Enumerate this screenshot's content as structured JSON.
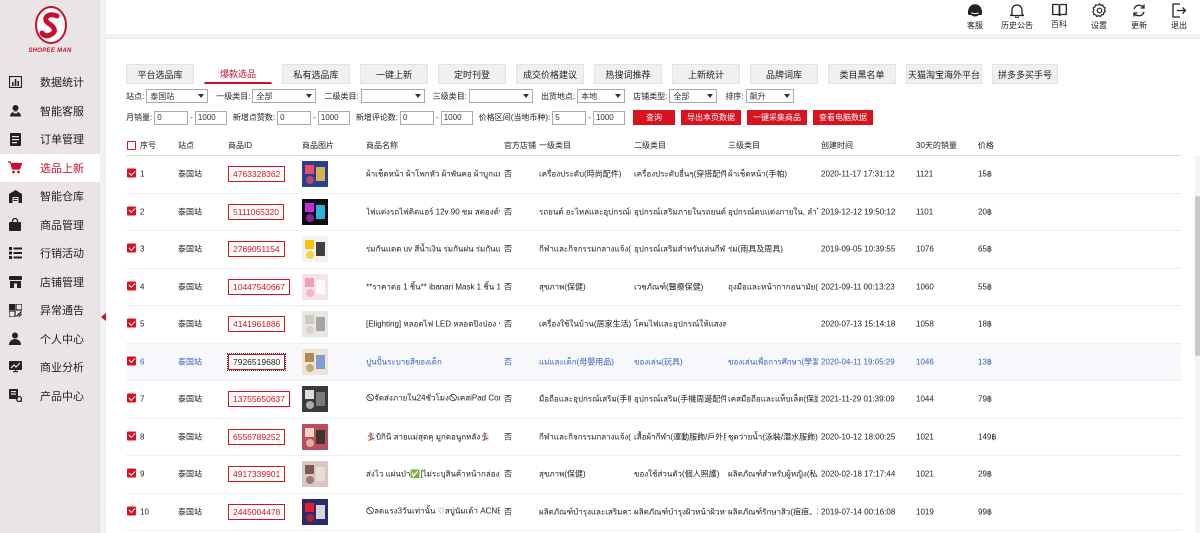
{
  "brand": {
    "logo_text": "SHOPEE MAN"
  },
  "sidebar": {
    "items": [
      {
        "label": "数据统计",
        "icon": "bar-chart-icon"
      },
      {
        "label": "智能客服",
        "icon": "user-service-icon"
      },
      {
        "label": "订单管理",
        "icon": "document-icon"
      },
      {
        "label": "选品上新",
        "icon": "cart-icon",
        "active": true
      },
      {
        "label": "智能仓库",
        "icon": "warehouse-icon"
      },
      {
        "label": "商品管理",
        "icon": "shopping-bag-icon"
      },
      {
        "label": "行销活动",
        "icon": "list-icon"
      },
      {
        "label": "店铺管理",
        "icon": "store-icon"
      },
      {
        "label": "异常通告",
        "icon": "alert-icon"
      },
      {
        "label": "个人中心",
        "icon": "person-icon"
      },
      {
        "label": "商业分析",
        "icon": "analysis-icon"
      },
      {
        "label": "产品中心",
        "icon": "product-icon"
      }
    ]
  },
  "header": {
    "icons": [
      {
        "label": "客服",
        "icon": "headset-icon"
      },
      {
        "label": "历史公告",
        "icon": "bell-icon"
      },
      {
        "label": "百科",
        "icon": "book-icon"
      },
      {
        "label": "设置",
        "icon": "gear-icon"
      },
      {
        "label": "更新",
        "icon": "refresh-icon"
      },
      {
        "label": "退出",
        "icon": "logout-icon"
      }
    ]
  },
  "tabs": [
    "平台选品库",
    "爆款选品",
    "私有选品库",
    "一键上新",
    "定时刊登",
    "成交价格建议",
    "热搜词推荐",
    "上新统计",
    "品牌词库",
    "类目黑名单",
    "天猫淘宝海外平台",
    "拼多多买手号"
  ],
  "active_tab": 1,
  "filters": {
    "site_label": "站点:",
    "site_value": "泰国站",
    "cat1_label": "一级类目:",
    "cat1_value": "全部",
    "cat2_label": "二级类目:",
    "cat2_value": "",
    "cat3_label": "三级类目:",
    "cat3_value": "",
    "origin_label": "出货地点:",
    "origin_value": "本地",
    "shop_type_label": "店铺类型:",
    "shop_type_value": "全部",
    "sort_label": "排序:",
    "sort_value": "飙升",
    "monthly_sales_label": "月销量:",
    "monthly_sales_min": "0",
    "monthly_sales_max": "1000",
    "new_collect_label": "新增点赞数:",
    "new_collect_min": "0",
    "new_collect_max": "1000",
    "new_review_label": "新增评论数:",
    "new_review_min": "0",
    "new_review_max": "1000",
    "price_label": "价格区间(当地币种):",
    "price_min": "5",
    "price_max": "1000"
  },
  "buttons": {
    "query": "查询",
    "export_page": "导出本页数据",
    "one_click_collect": "一键采集商品",
    "view_detail": "查看电脑数据"
  },
  "table": {
    "headers": [
      "序号",
      "站点",
      "商品ID",
      "商品图片",
      "商品名称",
      "官方店铺",
      "一级类目",
      "二级类目",
      "三级类目",
      "创建时间",
      "30天的销量",
      "价格"
    ],
    "rows": [
      {
        "no": "1",
        "site": "泰国站",
        "id": "4763328362",
        "name": "ผ้าเช็ดหน้า ผ้าโพกหัว ผ้าพันคอ ผ้าบูกแม ผ้าโพ",
        "official": "否",
        "cat1": "เครื่องประดับ(時尚配件)",
        "cat2": "เครื่องประดับอื่นๆ(穿搭配件)",
        "cat3": "ผ้าเช็ดหน้า(手帕)",
        "created": "2020-11-17 17:31:12",
        "sales": "1121",
        "price": "15฿",
        "checked": true
      },
      {
        "no": "2",
        "site": "泰国站",
        "id": "5111065320",
        "name": "ไฟแต่งรถไฟติดแอร์ 12v 90 ซม สตองด์ท์ สว่างชัด",
        "official": "否",
        "cat1": "รถยนต์ อะไหล่และอุปกรณ์เสริมรถ",
        "cat2": "อุปกรณ์เสริมภายในรถยนต์(車內)",
        "cat3": "อุปกรณ์ตบแต่งภายใน, ลำโพงและอ",
        "created": "2019-12-12 19:50:12",
        "sales": "1101",
        "price": "20฿",
        "checked": true
      },
      {
        "no": "3",
        "site": "泰国站",
        "id": "2769051154",
        "name": "ร่มกันแดด uv สีน้ำเงิน ร่มกันฝน ร่มกันแดด ร่มก",
        "official": "否",
        "cat1": "กีฬาและกิจกรรมกลางแจ้ง(戶外)",
        "cat2": "อุปกรณ์เสริมสำหรับเล่นกีฬาและ",
        "cat3": "ร่ม(雨具及周具)",
        "created": "2019-09-05 10:39:55",
        "sales": "1076",
        "price": "65฿",
        "checked": true
      },
      {
        "no": "4",
        "site": "泰国站",
        "id": "10447540667",
        "name": "**ราคาต่อ 1 ชิ้น** ibanari Mask 1 ชิ้น 1 ซ",
        "official": "否",
        "cat1": "สุขภาพ(保健)",
        "cat2": "เวชภัณฑ์(醫療保健)",
        "cat3": "ถุงมือและหน้ากากอนามัย(醫用",
        "created": "2021-09-11 00:13:23",
        "sales": "1060",
        "price": "55฿",
        "checked": true
      },
      {
        "no": "5",
        "site": "泰国站",
        "id": "4141961886",
        "name": "[Elighting] หลอดไฟ LED หลอดปิงปอง รุ่น A",
        "official": "否",
        "cat1": "เครื่องใช้ในบ้าน(居家生活)",
        "cat2": "โคมไฟและอุปกรณ์ให้แสงสว่าง(燈",
        "cat3": "",
        "created": "2020-07-13 15:14:18",
        "sales": "1058",
        "price": "18฿",
        "checked": true
      },
      {
        "no": "6",
        "site": "泰国站",
        "id": "7926519680",
        "name": "ปูนปั้นระบายสีของเด็ก",
        "official": "否",
        "cat1": "แม่และเด็ก(母嬰用品)",
        "cat2": "ของเล่น(玩具)",
        "cat3": "ของเล่นเพื่อการศึกษา(學習教具",
        "created": "2020-04-11 19:05:29",
        "sales": "1046",
        "price": "13฿",
        "checked": true,
        "highlight": true
      },
      {
        "no": "7",
        "site": "泰国站",
        "id": "13755650637",
        "name": "🛇จัดส่งภายใน24ชั่วโมง🛇เคสiPad Composi",
        "official": "否",
        "cat1": "มือถือและอุปกรณ์เสริม(手機平",
        "cat2": "อุปกรณ์เสริม(手機周邊配件)",
        "cat3": "เคสมือถือและแท็บเล็ต(保護殼)",
        "created": "2021-11-29 01:39:09",
        "sales": "1044",
        "price": "79฿",
        "checked": true
      },
      {
        "no": "8",
        "site": "泰国站",
        "id": "6556789252",
        "name": "🏂บิกินี สายแม่สุดคุ มูกดอนูกหลัง🏂",
        "official": "否",
        "cat1": "กีฬาและกิจกรรมกลางแจ้ง(戶外",
        "cat2": "เสื้อผ้ากีฬา(運動服飾/戶外服",
        "cat3": "ชุดว่ายน้ำ(泳裝/潛水服飾)",
        "created": "2020-10-12 18:00:25",
        "sales": "1021",
        "price": "149฿",
        "checked": true
      },
      {
        "no": "9",
        "site": "泰国站",
        "id": "4917339901",
        "name": "ส่งไว แผ่นป่า✅[ไม่ระบุสินค้าหน้ากล่อง] ที่ตรวจ",
        "official": "否",
        "cat1": "สุขภาพ(保健)",
        "cat2": "ของใช้ส่วนตัว(個人照護)",
        "cat3": "ผลิตภัณฑ์สำหรับผู้หญิง(私密護",
        "created": "2020-02-18 17:17:44",
        "sales": "1021",
        "price": "29฿",
        "checked": true
      },
      {
        "no": "10",
        "site": "泰国站",
        "id": "2445004478",
        "name": "🛇ลดแรง3วันเท่านั้น ♡สบู่นัมเด้า ACNE-EX",
        "official": "否",
        "cat1": "ผลิตภัณฑ์บำรุงและเสริมความงาม",
        "cat2": "ผลิตภัณฑ์บำรุงผิวหน้าผิวหน้า(肌",
        "cat3": "ผลิตภัณฑ์รักษาสิว(痘痘、粉刺",
        "created": "2019-07-14 00:16:08",
        "sales": "1019",
        "price": "99฿",
        "checked": true
      }
    ]
  },
  "colors": {
    "accent": "#d9121f",
    "highlight_text": "#3b63c4"
  }
}
